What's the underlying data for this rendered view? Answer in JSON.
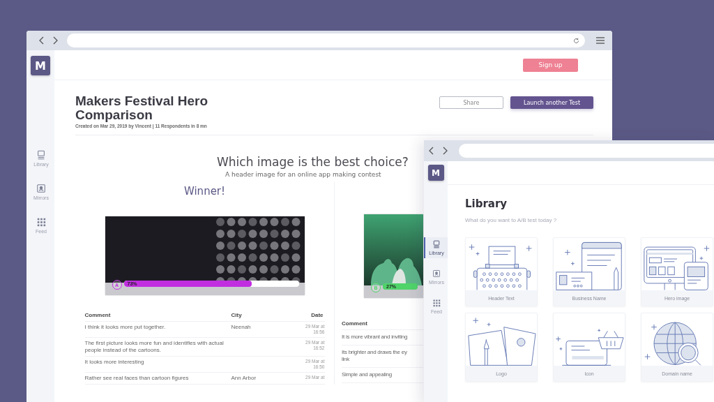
{
  "window_main": {
    "sidebar": {
      "logo": "M",
      "items": [
        {
          "kind": "monitor",
          "label": "Library",
          "selected": false
        },
        {
          "kind": "portrait",
          "label": "Mirrors",
          "selected": false
        },
        {
          "kind": "grid",
          "label": "Feed",
          "selected": false
        }
      ]
    },
    "header": {
      "signup": "Sign up"
    },
    "test": {
      "title": "Makers Festival Hero Comparison",
      "meta": "Created on Mar 29, 2019 by Vincent | 11 Respondents in 8 mn",
      "buttons": [
        {
          "kind": "outline",
          "label": "Share"
        },
        {
          "kind": "primary",
          "label": "Launch another Test"
        }
      ]
    },
    "question": "Which image is the best choice?",
    "subtitle": "A header image for an online app making contest",
    "variants": [
      {
        "badge": "Winner!",
        "kind": "banner",
        "letter": "A",
        "level": 0.73,
        "reading": "73%",
        "color": "#c02ee0",
        "columns": [
          "Comment",
          "City",
          "Date"
        ],
        "rows": [
          [
            "I think it looks more put together.",
            "Neenah",
            "29 Mar at 16:56"
          ],
          [
            "The first picture looks more fun and identifies with actual people instead of the cartoons.",
            "",
            "29 Mar at 16:52"
          ],
          [
            "It looks more interesting",
            "",
            "29 Mar at 16:50"
          ],
          [
            "Rather see real faces than cartoon figures",
            "Ann Arbor",
            "29 Mar at"
          ]
        ]
      },
      {
        "kind": "illustration",
        "letter": "B",
        "level": 0.27,
        "reading": "27%",
        "color": "#4fd46a",
        "columns": [
          "Comment"
        ],
        "rows": [
          [
            "It is more vibrant and inviting"
          ],
          [
            "Its brighter and draws the ey\nlink"
          ],
          [
            "Simple and appealing"
          ]
        ]
      }
    ]
  },
  "window_library": {
    "sidebar": {
      "logo": "M",
      "items": [
        {
          "kind": "monitor",
          "label": "Library",
          "selected": true
        },
        {
          "kind": "portrait",
          "label": "Mirrors",
          "selected": false
        },
        {
          "kind": "grid",
          "label": "Feed",
          "selected": false
        }
      ]
    },
    "title": "Library",
    "subtitle": "What do you want to A/B test today ?",
    "cards": [
      {
        "kind": "typewriter",
        "label": "Header Text"
      },
      {
        "kind": "document",
        "label": "Business Name"
      },
      {
        "kind": "devices",
        "label": "Hero image"
      },
      {
        "kind": "art",
        "label": "Logo"
      },
      {
        "kind": "shop",
        "label": "Icon"
      },
      {
        "kind": "globe",
        "label": "Domain name"
      }
    ]
  }
}
